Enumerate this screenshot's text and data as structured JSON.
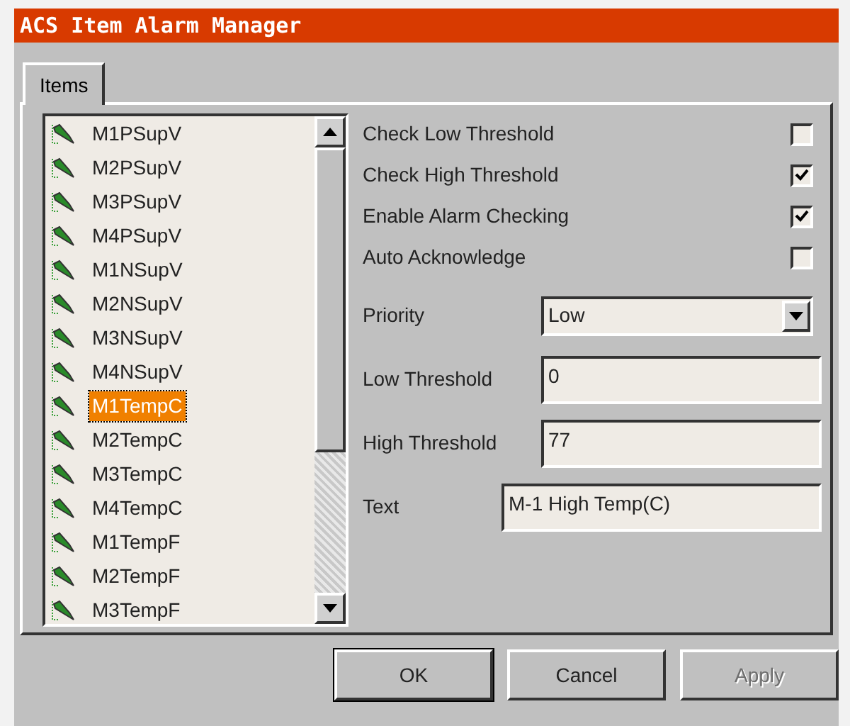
{
  "window": {
    "title": "ACS Item Alarm Manager"
  },
  "tabs": [
    {
      "label": "Items",
      "selected": true
    }
  ],
  "items": [
    {
      "label": "M1PSupV",
      "selected": false
    },
    {
      "label": "M2PSupV",
      "selected": false
    },
    {
      "label": "M3PSupV",
      "selected": false
    },
    {
      "label": "M4PSupV",
      "selected": false
    },
    {
      "label": "M1NSupV",
      "selected": false
    },
    {
      "label": "M2NSupV",
      "selected": false
    },
    {
      "label": "M3NSupV",
      "selected": false
    },
    {
      "label": "M4NSupV",
      "selected": false
    },
    {
      "label": "M1TempC",
      "selected": true
    },
    {
      "label": "M2TempC",
      "selected": false
    },
    {
      "label": "M3TempC",
      "selected": false
    },
    {
      "label": "M4TempC",
      "selected": false
    },
    {
      "label": "M1TempF",
      "selected": false
    },
    {
      "label": "M2TempF",
      "selected": false
    },
    {
      "label": "M3TempF",
      "selected": false
    }
  ],
  "checkboxes": [
    {
      "label": "Check Low Threshold",
      "checked": false
    },
    {
      "label": "Check High Threshold",
      "checked": true
    },
    {
      "label": "Enable Alarm Checking",
      "checked": true
    },
    {
      "label": "Auto Acknowledge",
      "checked": false
    }
  ],
  "fields": [
    {
      "kind": "dropdown",
      "label": "Priority",
      "value": "Low"
    },
    {
      "kind": "text",
      "label": "Low Threshold",
      "value": "0"
    },
    {
      "kind": "text",
      "label": "High Threshold",
      "value": "77"
    },
    {
      "kind": "wide",
      "label": "Text",
      "value": "M-1 High Temp(C)"
    }
  ],
  "buttons": [
    {
      "label": "OK",
      "disabled": false,
      "default": true
    },
    {
      "label": "Cancel",
      "disabled": false,
      "default": false
    },
    {
      "label": "Apply",
      "disabled": true,
      "default": false
    }
  ]
}
